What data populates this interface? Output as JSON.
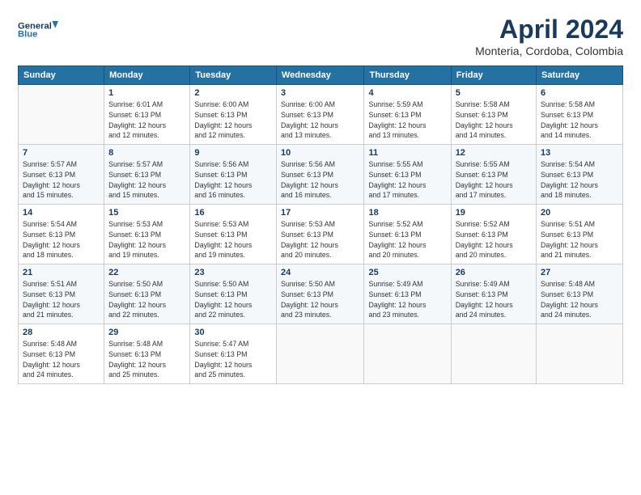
{
  "logo": {
    "line1": "General",
    "line2": "Blue"
  },
  "header": {
    "title": "April 2024",
    "subtitle": "Monteria, Cordoba, Colombia"
  },
  "columns": [
    "Sunday",
    "Monday",
    "Tuesday",
    "Wednesday",
    "Thursday",
    "Friday",
    "Saturday"
  ],
  "weeks": [
    [
      {
        "day": "",
        "detail": ""
      },
      {
        "day": "1",
        "detail": "Sunrise: 6:01 AM\nSunset: 6:13 PM\nDaylight: 12 hours\nand 12 minutes."
      },
      {
        "day": "2",
        "detail": "Sunrise: 6:00 AM\nSunset: 6:13 PM\nDaylight: 12 hours\nand 12 minutes."
      },
      {
        "day": "3",
        "detail": "Sunrise: 6:00 AM\nSunset: 6:13 PM\nDaylight: 12 hours\nand 13 minutes."
      },
      {
        "day": "4",
        "detail": "Sunrise: 5:59 AM\nSunset: 6:13 PM\nDaylight: 12 hours\nand 13 minutes."
      },
      {
        "day": "5",
        "detail": "Sunrise: 5:58 AM\nSunset: 6:13 PM\nDaylight: 12 hours\nand 14 minutes."
      },
      {
        "day": "6",
        "detail": "Sunrise: 5:58 AM\nSunset: 6:13 PM\nDaylight: 12 hours\nand 14 minutes."
      }
    ],
    [
      {
        "day": "7",
        "detail": "Sunrise: 5:57 AM\nSunset: 6:13 PM\nDaylight: 12 hours\nand 15 minutes."
      },
      {
        "day": "8",
        "detail": "Sunrise: 5:57 AM\nSunset: 6:13 PM\nDaylight: 12 hours\nand 15 minutes."
      },
      {
        "day": "9",
        "detail": "Sunrise: 5:56 AM\nSunset: 6:13 PM\nDaylight: 12 hours\nand 16 minutes."
      },
      {
        "day": "10",
        "detail": "Sunrise: 5:56 AM\nSunset: 6:13 PM\nDaylight: 12 hours\nand 16 minutes."
      },
      {
        "day": "11",
        "detail": "Sunrise: 5:55 AM\nSunset: 6:13 PM\nDaylight: 12 hours\nand 17 minutes."
      },
      {
        "day": "12",
        "detail": "Sunrise: 5:55 AM\nSunset: 6:13 PM\nDaylight: 12 hours\nand 17 minutes."
      },
      {
        "day": "13",
        "detail": "Sunrise: 5:54 AM\nSunset: 6:13 PM\nDaylight: 12 hours\nand 18 minutes."
      }
    ],
    [
      {
        "day": "14",
        "detail": "Sunrise: 5:54 AM\nSunset: 6:13 PM\nDaylight: 12 hours\nand 18 minutes."
      },
      {
        "day": "15",
        "detail": "Sunrise: 5:53 AM\nSunset: 6:13 PM\nDaylight: 12 hours\nand 19 minutes."
      },
      {
        "day": "16",
        "detail": "Sunrise: 5:53 AM\nSunset: 6:13 PM\nDaylight: 12 hours\nand 19 minutes."
      },
      {
        "day": "17",
        "detail": "Sunrise: 5:53 AM\nSunset: 6:13 PM\nDaylight: 12 hours\nand 20 minutes."
      },
      {
        "day": "18",
        "detail": "Sunrise: 5:52 AM\nSunset: 6:13 PM\nDaylight: 12 hours\nand 20 minutes."
      },
      {
        "day": "19",
        "detail": "Sunrise: 5:52 AM\nSunset: 6:13 PM\nDaylight: 12 hours\nand 20 minutes."
      },
      {
        "day": "20",
        "detail": "Sunrise: 5:51 AM\nSunset: 6:13 PM\nDaylight: 12 hours\nand 21 minutes."
      }
    ],
    [
      {
        "day": "21",
        "detail": "Sunrise: 5:51 AM\nSunset: 6:13 PM\nDaylight: 12 hours\nand 21 minutes."
      },
      {
        "day": "22",
        "detail": "Sunrise: 5:50 AM\nSunset: 6:13 PM\nDaylight: 12 hours\nand 22 minutes."
      },
      {
        "day": "23",
        "detail": "Sunrise: 5:50 AM\nSunset: 6:13 PM\nDaylight: 12 hours\nand 22 minutes."
      },
      {
        "day": "24",
        "detail": "Sunrise: 5:50 AM\nSunset: 6:13 PM\nDaylight: 12 hours\nand 23 minutes."
      },
      {
        "day": "25",
        "detail": "Sunrise: 5:49 AM\nSunset: 6:13 PM\nDaylight: 12 hours\nand 23 minutes."
      },
      {
        "day": "26",
        "detail": "Sunrise: 5:49 AM\nSunset: 6:13 PM\nDaylight: 12 hours\nand 24 minutes."
      },
      {
        "day": "27",
        "detail": "Sunrise: 5:48 AM\nSunset: 6:13 PM\nDaylight: 12 hours\nand 24 minutes."
      }
    ],
    [
      {
        "day": "28",
        "detail": "Sunrise: 5:48 AM\nSunset: 6:13 PM\nDaylight: 12 hours\nand 24 minutes."
      },
      {
        "day": "29",
        "detail": "Sunrise: 5:48 AM\nSunset: 6:13 PM\nDaylight: 12 hours\nand 25 minutes."
      },
      {
        "day": "30",
        "detail": "Sunrise: 5:47 AM\nSunset: 6:13 PM\nDaylight: 12 hours\nand 25 minutes."
      },
      {
        "day": "",
        "detail": ""
      },
      {
        "day": "",
        "detail": ""
      },
      {
        "day": "",
        "detail": ""
      },
      {
        "day": "",
        "detail": ""
      }
    ]
  ]
}
